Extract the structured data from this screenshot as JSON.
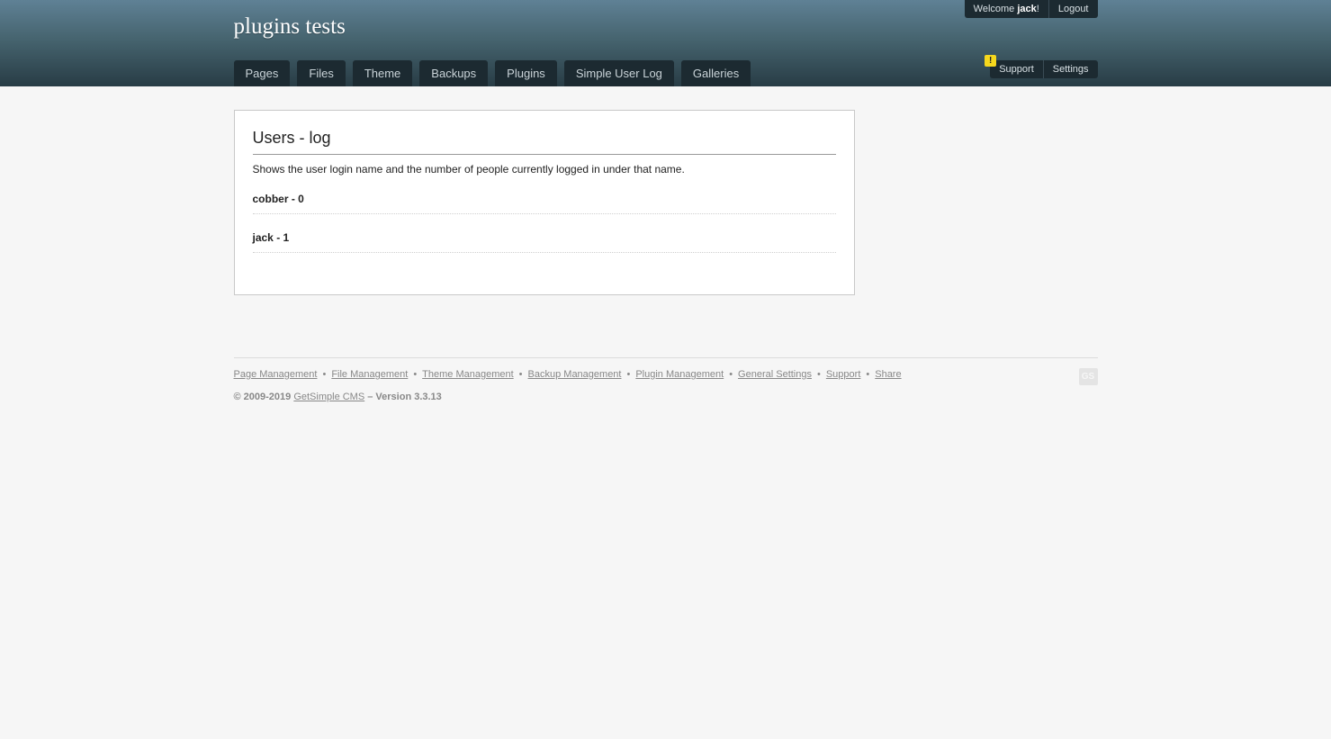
{
  "site": {
    "title": "plugins tests"
  },
  "nav": {
    "tabs": [
      {
        "label": "Pages"
      },
      {
        "label": "Files"
      },
      {
        "label": "Theme"
      },
      {
        "label": "Backups"
      },
      {
        "label": "Plugins"
      },
      {
        "label": "Simple User Log"
      },
      {
        "label": "Galleries"
      }
    ]
  },
  "user_box": {
    "welcome_prefix": "Welcome ",
    "username": "jack",
    "welcome_suffix": "!",
    "logout": "Logout"
  },
  "settings_box": {
    "warning_icon": "!",
    "support": "Support",
    "settings": "Settings"
  },
  "panel": {
    "title": "Users - log",
    "description": "Shows the user login name and the number of people currently logged in under that name.",
    "users": [
      {
        "text": "cobber - 0"
      },
      {
        "text": "jack - 1"
      }
    ]
  },
  "footer": {
    "links": [
      {
        "label": "Page Management"
      },
      {
        "label": "File Management"
      },
      {
        "label": "Theme Management"
      },
      {
        "label": "Backup Management"
      },
      {
        "label": "Plugin Management"
      },
      {
        "label": "General Settings"
      },
      {
        "label": "Support"
      },
      {
        "label": "Share"
      }
    ],
    "separator": "•",
    "copyright_prefix": "© 2009-2019 ",
    "cms_link": "GetSimple CMS",
    "version_text": " – Version 3.3.13",
    "logo_text": "GS"
  }
}
